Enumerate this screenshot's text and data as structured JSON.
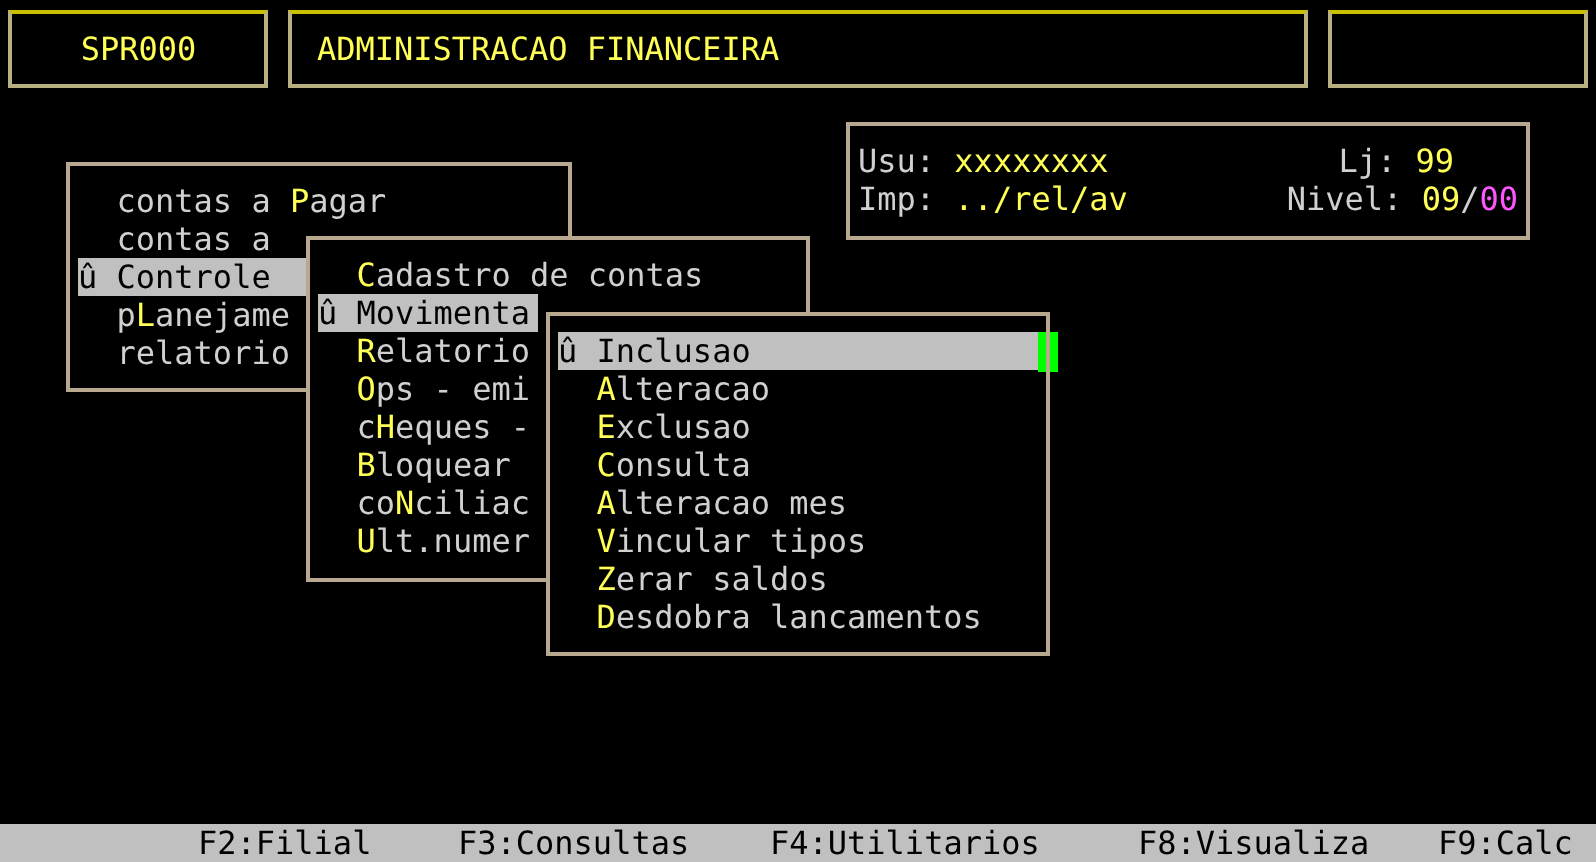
{
  "header": {
    "program": "SPR000",
    "title": "ADMINISTRACAO FINANCEIRA"
  },
  "info": {
    "user_label": "Usu:",
    "user": "xxxxxxxx",
    "store_label": "Lj:",
    "store": "99",
    "printer_label": "Imp:",
    "printer": "../rel/av",
    "level_label": "Nivel:",
    "level_value": "09",
    "level_separator": "/",
    "level_sub": "00"
  },
  "menus": [
    {
      "items": [
        {
          "pre": "contas a ",
          "hotkey": "P",
          "post": "agar",
          "selected": false
        },
        {
          "pre": "contas a",
          "selected": false
        },
        {
          "marker": "û",
          "pre": "Controle",
          "selected": true
        },
        {
          "pre": "p",
          "hotkey": "L",
          "post": "anejame",
          "selected": false
        },
        {
          "pre": "relatorio",
          "selected": false
        }
      ]
    },
    {
      "items": [
        {
          "hotkey": "C",
          "post": "adastro de contas",
          "selected": false
        },
        {
          "marker": "û",
          "pre": "Movimenta",
          "selected": true
        },
        {
          "hotkey": "R",
          "post": "elatorio",
          "selected": false
        },
        {
          "hotkey": "O",
          "post": "ps - emi",
          "selected": false
        },
        {
          "pre": "c",
          "hotkey": "H",
          "post": "eques -",
          "selected": false
        },
        {
          "hotkey": "B",
          "post": "loquear",
          "selected": false
        },
        {
          "pre": "co",
          "hotkey": "N",
          "post": "ciliac",
          "selected": false
        },
        {
          "hotkey": "U",
          "post": "lt.numer",
          "selected": false
        }
      ]
    },
    {
      "items": [
        {
          "marker": "û",
          "pre": "Inclusao",
          "selected": true
        },
        {
          "hotkey": "A",
          "post": "lteracao",
          "selected": false
        },
        {
          "hotkey": "E",
          "post": "xclusao",
          "selected": false
        },
        {
          "hotkey": "C",
          "post": "onsulta",
          "selected": false
        },
        {
          "hotkey": "A",
          "post": "lteracao mes",
          "selected": false
        },
        {
          "hotkey": "V",
          "post": "incular tipos",
          "selected": false
        },
        {
          "hotkey": "Z",
          "post": "erar saldos",
          "selected": false
        },
        {
          "hotkey": "D",
          "post": "esdobra lancamentos",
          "selected": false
        }
      ]
    }
  ],
  "function_keys": [
    "F2:Filial",
    "F3:Consultas",
    "F4:Utilitarios",
    "F8:Visualiza",
    "F9:Calc"
  ]
}
